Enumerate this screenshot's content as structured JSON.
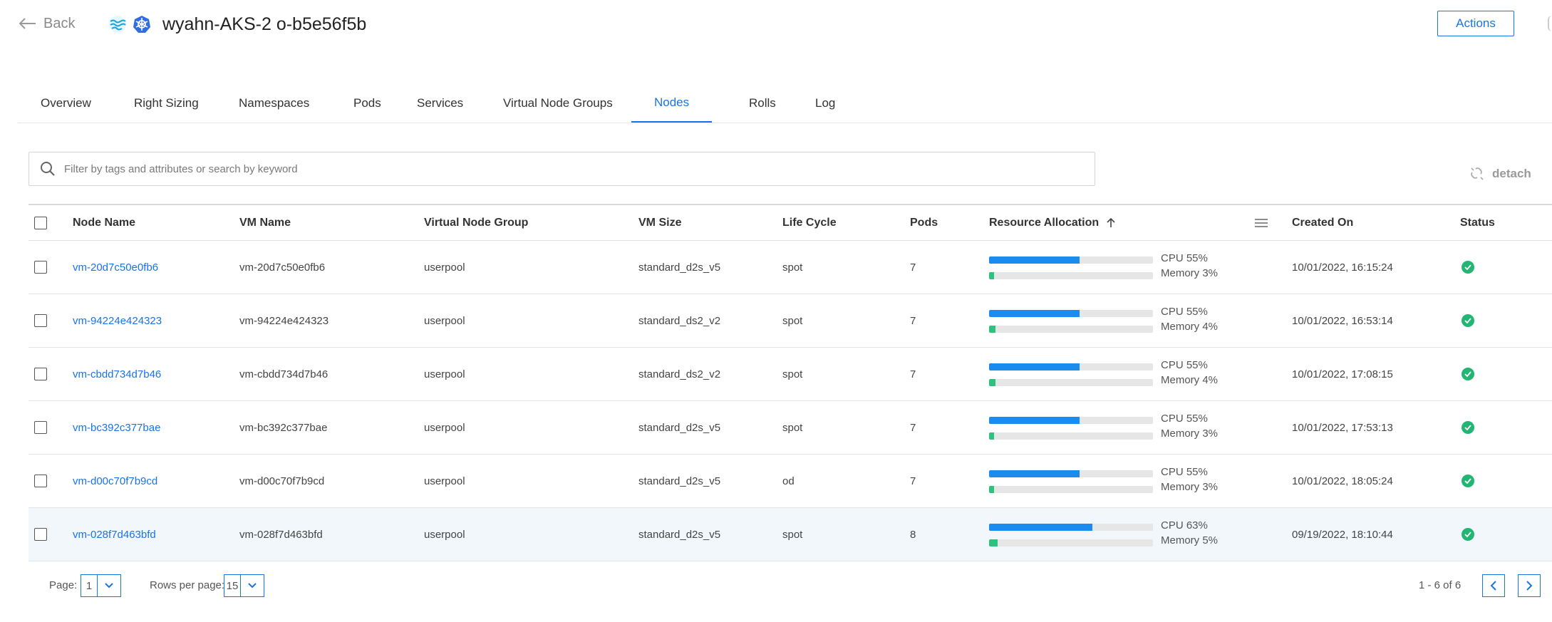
{
  "header": {
    "back_label": "Back",
    "cluster_name": "wyahn-AKS-2",
    "cluster_id": "o-b5e56f5b",
    "actions_label": "Actions"
  },
  "tabs": [
    {
      "label": "Overview"
    },
    {
      "label": "Right Sizing"
    },
    {
      "label": "Namespaces"
    },
    {
      "label": "Pods"
    },
    {
      "label": "Services"
    },
    {
      "label": "Virtual Node Groups"
    },
    {
      "label": "Nodes",
      "active": true
    },
    {
      "label": "Rolls"
    },
    {
      "label": "Log"
    }
  ],
  "search": {
    "placeholder": "Filter by tags and attributes or search by keyword"
  },
  "detach_label": "detach",
  "columns": {
    "node_name": "Node Name",
    "vm_name": "VM Name",
    "vng": "Virtual Node Group",
    "vm_size": "VM Size",
    "life_cycle": "Life Cycle",
    "pods": "Pods",
    "resource": "Resource Allocation",
    "created": "Created On",
    "status": "Status"
  },
  "rows": [
    {
      "node": "vm-20d7c50e0fb6",
      "vm": "vm-20d7c50e0fb6",
      "vng": "userpool",
      "size": "standard_d2s_v5",
      "life": "spot",
      "pods": "7",
      "cpu_label": "CPU 55%",
      "cpu": 55,
      "mem_label": "Memory 3%",
      "mem": 3,
      "created": "10/01/2022, 16:15:24",
      "status": "ok"
    },
    {
      "node": "vm-94224e424323",
      "vm": "vm-94224e424323",
      "vng": "userpool",
      "size": "standard_ds2_v2",
      "life": "spot",
      "pods": "7",
      "cpu_label": "CPU 55%",
      "cpu": 55,
      "mem_label": "Memory 4%",
      "mem": 4,
      "created": "10/01/2022, 16:53:14",
      "status": "ok"
    },
    {
      "node": "vm-cbdd734d7b46",
      "vm": "vm-cbdd734d7b46",
      "vng": "userpool",
      "size": "standard_ds2_v2",
      "life": "spot",
      "pods": "7",
      "cpu_label": "CPU 55%",
      "cpu": 55,
      "mem_label": "Memory 4%",
      "mem": 4,
      "created": "10/01/2022, 17:08:15",
      "status": "ok"
    },
    {
      "node": "vm-bc392c377bae",
      "vm": "vm-bc392c377bae",
      "vng": "userpool",
      "size": "standard_d2s_v5",
      "life": "spot",
      "pods": "7",
      "cpu_label": "CPU 55%",
      "cpu": 55,
      "mem_label": "Memory 3%",
      "mem": 3,
      "created": "10/01/2022, 17:53:13",
      "status": "ok"
    },
    {
      "node": "vm-d00c70f7b9cd",
      "vm": "vm-d00c70f7b9cd",
      "vng": "userpool",
      "size": "standard_d2s_v5",
      "life": "od",
      "pods": "7",
      "cpu_label": "CPU 55%",
      "cpu": 55,
      "mem_label": "Memory 3%",
      "mem": 3,
      "created": "10/01/2022, 18:05:24",
      "status": "ok"
    },
    {
      "node": "vm-028f7d463bfd",
      "vm": "vm-028f7d463bfd",
      "vng": "userpool",
      "size": "standard_d2s_v5",
      "life": "spot",
      "pods": "8",
      "cpu_label": "CPU 63%",
      "cpu": 63,
      "mem_label": "Memory 5%",
      "mem": 5,
      "created": "09/19/2022, 18:10:44",
      "status": "ok",
      "highlighted": true
    }
  ],
  "footer": {
    "page_label": "Page:",
    "page_value": "1",
    "rows_label": "Rows per page:",
    "rows_value": "15",
    "count_text": "1 - 6 of 6"
  },
  "colors": {
    "accent": "#1a73e8",
    "cpu_bar": "#1a8cf0",
    "memory_bar": "#2ec27e",
    "status_ok": "#22b573"
  }
}
